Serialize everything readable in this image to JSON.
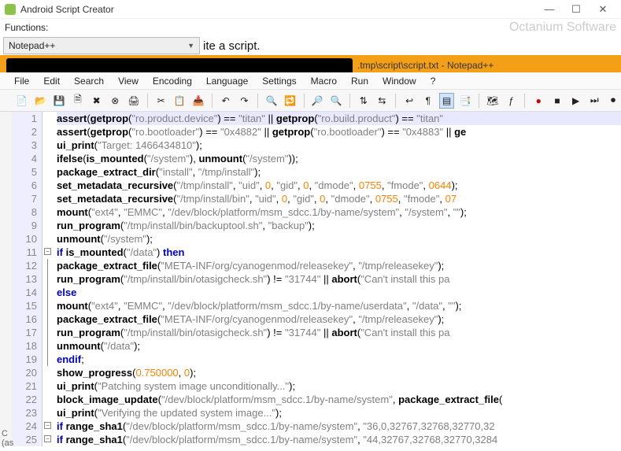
{
  "outer": {
    "title": "Android Script Creator",
    "min": "—",
    "max": "☐",
    "close": "✕"
  },
  "func": {
    "label": "Functions:",
    "watermark": "Octanium Software"
  },
  "subline": {
    "dropdown_value": "Notepad++",
    "text": "ite a script."
  },
  "npp": {
    "tab_suffix": ".tmp\\script\\script.txt - Notepad++"
  },
  "menus": [
    "File",
    "Edit",
    "Search",
    "View",
    "Encoding",
    "Language",
    "Settings",
    "Macro",
    "Run",
    "Window",
    "?"
  ],
  "gutter": [
    "1",
    "2",
    "3",
    "4",
    "5",
    "6",
    "7",
    "8",
    "9",
    "10",
    "11",
    "12",
    "13",
    "14",
    "15",
    "16",
    "17",
    "18",
    "19",
    "20",
    "21",
    "22",
    "23",
    "24",
    "25"
  ],
  "code": [
    {
      "hl": true,
      "tokens": [
        [
          "fn",
          "assert"
        ],
        [
          "op",
          "("
        ],
        [
          "fn",
          "getprop"
        ],
        [
          "op",
          "("
        ],
        [
          "str",
          "\"ro.product.device\""
        ],
        [
          "op",
          ") "
        ],
        [
          "op",
          "== "
        ],
        [
          "str",
          "\"titan\""
        ],
        [
          "op",
          " || "
        ],
        [
          "fn",
          "getprop"
        ],
        [
          "op",
          "("
        ],
        [
          "str",
          "\"ro.build.product\""
        ],
        [
          "op",
          ") "
        ],
        [
          "op",
          "== "
        ],
        [
          "str",
          "\"titan\""
        ]
      ]
    },
    {
      "tokens": [
        [
          "fn",
          "assert"
        ],
        [
          "op",
          "("
        ],
        [
          "fn",
          "getprop"
        ],
        [
          "op",
          "("
        ],
        [
          "str",
          "\"ro.bootloader\""
        ],
        [
          "op",
          ") "
        ],
        [
          "op",
          "== "
        ],
        [
          "str",
          "\"0x4882\""
        ],
        [
          "op",
          " || "
        ],
        [
          "fn",
          "getprop"
        ],
        [
          "op",
          "("
        ],
        [
          "str",
          "\"ro.bootloader\""
        ],
        [
          "op",
          ") "
        ],
        [
          "op",
          "== "
        ],
        [
          "str",
          "\"0x4883\""
        ],
        [
          "op",
          " || "
        ],
        [
          "fn",
          "ge"
        ]
      ]
    },
    {
      "tokens": [
        [
          "fn",
          "ui_print"
        ],
        [
          "op",
          "("
        ],
        [
          "str",
          "\"Target: 1466434810\""
        ],
        [
          "op",
          ");"
        ]
      ]
    },
    {
      "tokens": [
        [
          "fn",
          "ifelse"
        ],
        [
          "op",
          "("
        ],
        [
          "fn",
          "is_mounted"
        ],
        [
          "op",
          "("
        ],
        [
          "str",
          "\"/system\""
        ],
        [
          "op",
          "), "
        ],
        [
          "fn",
          "unmount"
        ],
        [
          "op",
          "("
        ],
        [
          "str",
          "\"/system\""
        ],
        [
          "op",
          "));"
        ]
      ]
    },
    {
      "tokens": [
        [
          "fn",
          "package_extract_dir"
        ],
        [
          "op",
          "("
        ],
        [
          "str",
          "\"install\""
        ],
        [
          "op",
          ", "
        ],
        [
          "str",
          "\"/tmp/install\""
        ],
        [
          "op",
          ");"
        ]
      ]
    },
    {
      "tokens": [
        [
          "fn",
          "set_metadata_recursive"
        ],
        [
          "op",
          "("
        ],
        [
          "str",
          "\"/tmp/install\""
        ],
        [
          "op",
          ", "
        ],
        [
          "str",
          "\"uid\""
        ],
        [
          "op",
          ", "
        ],
        [
          "num",
          "0"
        ],
        [
          "op",
          ", "
        ],
        [
          "str",
          "\"gid\""
        ],
        [
          "op",
          ", "
        ],
        [
          "num",
          "0"
        ],
        [
          "op",
          ", "
        ],
        [
          "str",
          "\"dmode\""
        ],
        [
          "op",
          ", "
        ],
        [
          "num",
          "0755"
        ],
        [
          "op",
          ", "
        ],
        [
          "str",
          "\"fmode\""
        ],
        [
          "op",
          ", "
        ],
        [
          "num",
          "0644"
        ],
        [
          "op",
          ");"
        ]
      ]
    },
    {
      "tokens": [
        [
          "fn",
          "set_metadata_recursive"
        ],
        [
          "op",
          "("
        ],
        [
          "str",
          "\"/tmp/install/bin\""
        ],
        [
          "op",
          ", "
        ],
        [
          "str",
          "\"uid\""
        ],
        [
          "op",
          ", "
        ],
        [
          "num",
          "0"
        ],
        [
          "op",
          ", "
        ],
        [
          "str",
          "\"gid\""
        ],
        [
          "op",
          ", "
        ],
        [
          "num",
          "0"
        ],
        [
          "op",
          ", "
        ],
        [
          "str",
          "\"dmode\""
        ],
        [
          "op",
          ", "
        ],
        [
          "num",
          "0755"
        ],
        [
          "op",
          ", "
        ],
        [
          "str",
          "\"fmode\""
        ],
        [
          "op",
          ", "
        ],
        [
          "num",
          "07"
        ]
      ]
    },
    {
      "tokens": [
        [
          "fn",
          "mount"
        ],
        [
          "op",
          "("
        ],
        [
          "str",
          "\"ext4\""
        ],
        [
          "op",
          ", "
        ],
        [
          "str",
          "\"EMMC\""
        ],
        [
          "op",
          ", "
        ],
        [
          "str",
          "\"/dev/block/platform/msm_sdcc.1/by-name/system\""
        ],
        [
          "op",
          ", "
        ],
        [
          "str",
          "\"/system\""
        ],
        [
          "op",
          ", "
        ],
        [
          "str",
          "\"\""
        ],
        [
          "op",
          ");"
        ]
      ]
    },
    {
      "tokens": [
        [
          "fn",
          "run_program"
        ],
        [
          "op",
          "("
        ],
        [
          "str",
          "\"/tmp/install/bin/backuptool.sh\""
        ],
        [
          "op",
          ", "
        ],
        [
          "str",
          "\"backup\""
        ],
        [
          "op",
          ");"
        ]
      ]
    },
    {
      "tokens": [
        [
          "fn",
          "unmount"
        ],
        [
          "op",
          "("
        ],
        [
          "str",
          "\"/system\""
        ],
        [
          "op",
          ");"
        ]
      ]
    },
    {
      "fold": "open",
      "tokens": [
        [
          "kw",
          "if"
        ],
        [
          "op",
          " "
        ],
        [
          "fn",
          "is_mounted"
        ],
        [
          "op",
          "("
        ],
        [
          "str",
          "\"/data\""
        ],
        [
          "op",
          ") "
        ],
        [
          "kw",
          "then"
        ]
      ]
    },
    {
      "tokens": [
        [
          "fn",
          "package_extract_file"
        ],
        [
          "op",
          "("
        ],
        [
          "str",
          "\"META-INF/org/cyanogenmod/releasekey\""
        ],
        [
          "op",
          ", "
        ],
        [
          "str",
          "\"/tmp/releasekey\""
        ],
        [
          "op",
          ");"
        ]
      ]
    },
    {
      "tokens": [
        [
          "fn",
          "run_program"
        ],
        [
          "op",
          "("
        ],
        [
          "str",
          "\"/tmp/install/bin/otasigcheck.sh\""
        ],
        [
          "op",
          ") "
        ],
        [
          "op",
          "!= "
        ],
        [
          "str",
          "\"31744\""
        ],
        [
          "op",
          " || "
        ],
        [
          "fn",
          "abort"
        ],
        [
          "op",
          "("
        ],
        [
          "str",
          "\"Can't install this pa"
        ]
      ]
    },
    {
      "tokens": [
        [
          "kw",
          "else"
        ]
      ]
    },
    {
      "tokens": [
        [
          "fn",
          "mount"
        ],
        [
          "op",
          "("
        ],
        [
          "str",
          "\"ext4\""
        ],
        [
          "op",
          ", "
        ],
        [
          "str",
          "\"EMMC\""
        ],
        [
          "op",
          ", "
        ],
        [
          "str",
          "\"/dev/block/platform/msm_sdcc.1/by-name/userdata\""
        ],
        [
          "op",
          ", "
        ],
        [
          "str",
          "\"/data\""
        ],
        [
          "op",
          ", "
        ],
        [
          "str",
          "\"\""
        ],
        [
          "op",
          ");"
        ]
      ]
    },
    {
      "tokens": [
        [
          "fn",
          "package_extract_file"
        ],
        [
          "op",
          "("
        ],
        [
          "str",
          "\"META-INF/org/cyanogenmod/releasekey\""
        ],
        [
          "op",
          ", "
        ],
        [
          "str",
          "\"/tmp/releasekey\""
        ],
        [
          "op",
          ");"
        ]
      ]
    },
    {
      "tokens": [
        [
          "fn",
          "run_program"
        ],
        [
          "op",
          "("
        ],
        [
          "str",
          "\"/tmp/install/bin/otasigcheck.sh\""
        ],
        [
          "op",
          ") "
        ],
        [
          "op",
          "!= "
        ],
        [
          "str",
          "\"31744\""
        ],
        [
          "op",
          " || "
        ],
        [
          "fn",
          "abort"
        ],
        [
          "op",
          "("
        ],
        [
          "str",
          "\"Can't install this pa"
        ]
      ]
    },
    {
      "tokens": [
        [
          "fn",
          "unmount"
        ],
        [
          "op",
          "("
        ],
        [
          "str",
          "\"/data\""
        ],
        [
          "op",
          ");"
        ]
      ]
    },
    {
      "tokens": [
        [
          "kw",
          "endif"
        ],
        [
          "op",
          ";"
        ]
      ]
    },
    {
      "tokens": [
        [
          "fn",
          "show_progress"
        ],
        [
          "op",
          "("
        ],
        [
          "num",
          "0.750000"
        ],
        [
          "op",
          ", "
        ],
        [
          "num",
          "0"
        ],
        [
          "op",
          ");"
        ]
      ]
    },
    {
      "tokens": [
        [
          "fn",
          "ui_print"
        ],
        [
          "op",
          "("
        ],
        [
          "str",
          "\"Patching system image unconditionally...\""
        ],
        [
          "op",
          ");"
        ]
      ]
    },
    {
      "tokens": [
        [
          "fn",
          "block_image_update"
        ],
        [
          "op",
          "("
        ],
        [
          "str",
          "\"/dev/block/platform/msm_sdcc.1/by-name/system\""
        ],
        [
          "op",
          ", "
        ],
        [
          "fn",
          "package_extract_file"
        ],
        [
          "op",
          "("
        ]
      ]
    },
    {
      "tokens": [
        [
          "fn",
          "ui_print"
        ],
        [
          "op",
          "("
        ],
        [
          "str",
          "\"Verifying the updated system image...\""
        ],
        [
          "op",
          ");"
        ]
      ]
    },
    {
      "fold": "open",
      "tokens": [
        [
          "kw",
          "if"
        ],
        [
          "op",
          " "
        ],
        [
          "fn",
          "range_sha1"
        ],
        [
          "op",
          "("
        ],
        [
          "str",
          "\"/dev/block/platform/msm_sdcc.1/by-name/system\""
        ],
        [
          "op",
          ", "
        ],
        [
          "str",
          "\"36,0,32767,32768,32770,32"
        ]
      ]
    },
    {
      "fold": "open",
      "tokens": [
        [
          "kw",
          "if"
        ],
        [
          "op",
          " "
        ],
        [
          "fn",
          "range_sha1"
        ],
        [
          "op",
          "("
        ],
        [
          "str",
          "\"/dev/block/platform/msm_sdcc.1/by-name/system\""
        ],
        [
          "op",
          ", "
        ],
        [
          "str",
          "\"44,32767,32768,32770,3284"
        ]
      ]
    }
  ],
  "frag": {
    "c": "C",
    "as": "(as"
  }
}
